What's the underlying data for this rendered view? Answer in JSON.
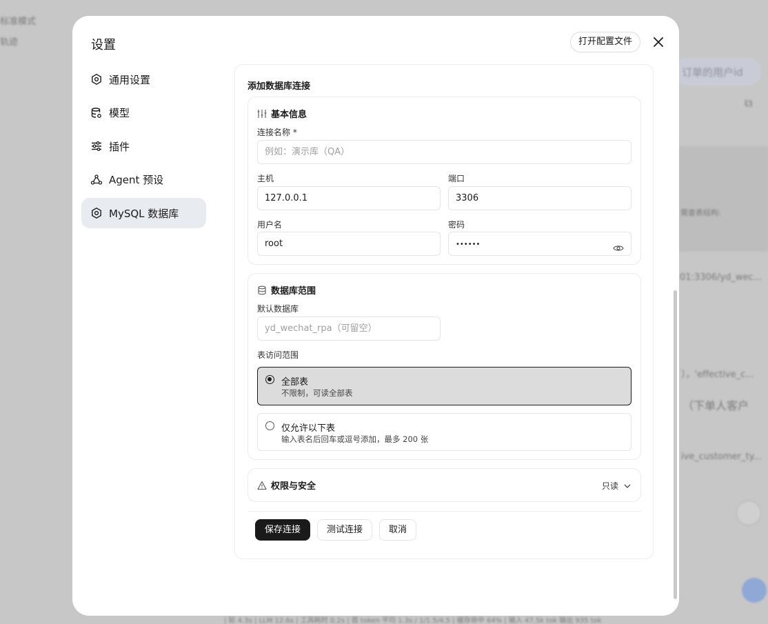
{
  "background": {
    "top_left_1": "标准模式",
    "top_left_2": "轨迹",
    "chip_text": "订单的用户id",
    "side_text_1": "需查表结构:",
    "side_text_2": "01:3306/yd_wec...",
    "side_text_3": "〕，'effective_c...",
    "side_text_4": "（下单人客户",
    "side_text_5": "ive_customer_ty...",
    "footer_text": "| 轮 4.3s | LLM 12.6s | 工具耗时 0.2s | 首 token 平均 1.3s / 1/1.5/4.5 | 缓存命中 64% | 输入 47.5k tok 输出 935 tok"
  },
  "modal": {
    "title": "设置",
    "open_config_label": "打开配置文件",
    "close_icon": "close-icon"
  },
  "sidebar": {
    "items": [
      {
        "label": "通用设置",
        "icon": "gear-icon"
      },
      {
        "label": "模型",
        "icon": "database-icon"
      },
      {
        "label": "插件",
        "icon": "sliders-icon"
      },
      {
        "label": "Agent 预设",
        "icon": "agent-icon"
      },
      {
        "label": "MySQL 数据库",
        "icon": "gear-icon",
        "active": true
      }
    ]
  },
  "form": {
    "title": "添加数据库连接",
    "basic": {
      "heading": "基本信息",
      "name_label": "连接名称 *",
      "name_placeholder": "例如：演示库（QA）",
      "host_label": "主机",
      "host_value": "127.0.0.1",
      "port_label": "端口",
      "port_value": "3306",
      "user_label": "用户名",
      "user_value": "root",
      "password_label": "密码",
      "password_value": "••••••"
    },
    "scope": {
      "heading": "数据库范围",
      "default_db_label": "默认数据库",
      "default_db_placeholder": "yd_wechat_rpa（可留空）",
      "table_scope_label": "表访问范围",
      "options": [
        {
          "title": "全部表",
          "desc": "不限制，可读全部表",
          "selected": true
        },
        {
          "title": "仅允许以下表",
          "desc": "输入表名后回车或逗号添加，最多 200 张",
          "selected": false
        }
      ]
    },
    "permission": {
      "heading": "权限与安全",
      "mode": "只读"
    },
    "actions": {
      "save": "保存连接",
      "test": "测试连接",
      "cancel": "取消"
    }
  }
}
